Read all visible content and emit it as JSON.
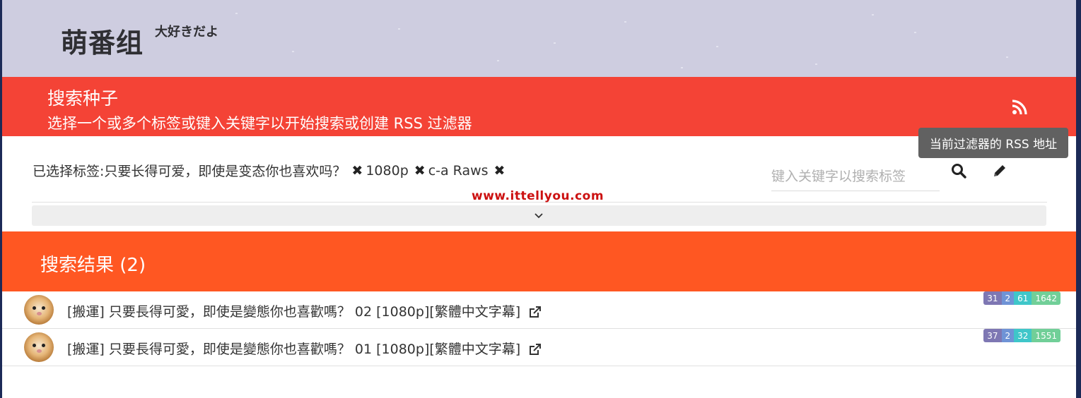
{
  "site": {
    "logo_text": "萌番组",
    "logo_sub": "大好きだよ"
  },
  "search": {
    "title": "搜索种子",
    "description": "选择一个或多个标签或键入关键字以开始搜索或创建 RSS 过滤器",
    "rss_tooltip": "当前过滤器的 RSS 地址",
    "selected_label": "已选择标签: ",
    "selected_tags": [
      "只要长得可爱，即使是变态你也喜欢吗？",
      "1080p",
      "c-a Raws"
    ],
    "keyword_input_value": "",
    "keyword_placeholder": "键入关键字以搜索标签",
    "remove_icon": "close-x-icon"
  },
  "watermark": "www.ittellyou.com",
  "results": {
    "title": "搜索结果 (2)",
    "items": [
      {
        "title": "[搬運] 只要長得可愛，即使是變態你也喜歡嗎？ 02 [1080p][繁體中文字幕]",
        "stats": [
          "31",
          "2",
          "61",
          "1642"
        ]
      },
      {
        "title": "[搬運] 只要長得可愛，即使是變態你也喜歡嗎？ 01 [1080p][繁體中文字幕]",
        "stats": [
          "37",
          "2",
          "32",
          "1551"
        ]
      }
    ]
  },
  "colors": {
    "banner_bg": "#cecde0",
    "search_header": "#f44336",
    "results_header": "#ff5722",
    "tooltip_bg": "#616161",
    "badge_colors": [
      "#7e77b3",
      "#6f93d6",
      "#3fc6c9",
      "#71cf98"
    ]
  }
}
